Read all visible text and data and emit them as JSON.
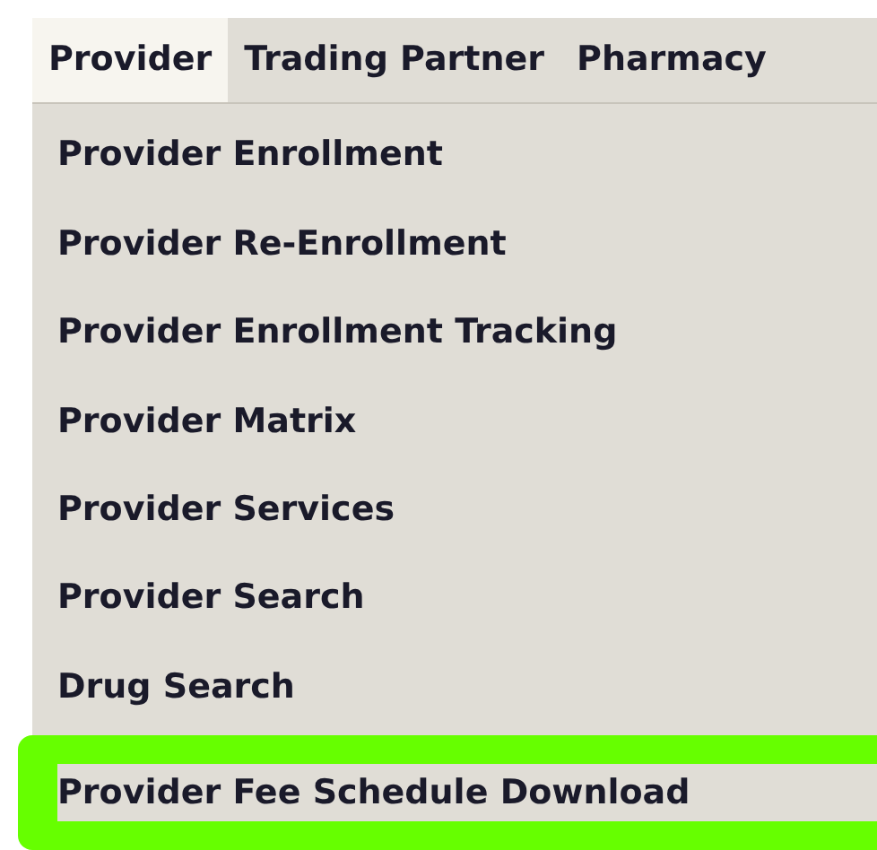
{
  "menu_bar": [
    {
      "label": "Provider",
      "selected": true
    },
    {
      "label": "Trading Partner",
      "selected": false
    },
    {
      "label": "Pharmacy",
      "selected": false
    }
  ],
  "dropdown": {
    "items": [
      {
        "label": "Provider Enrollment",
        "highlighted": false
      },
      {
        "label": "Provider Re-Enrollment",
        "highlighted": false
      },
      {
        "label": "Provider Enrollment Tracking",
        "highlighted": false
      },
      {
        "label": "Provider Matrix",
        "highlighted": false
      },
      {
        "label": "Provider Services",
        "highlighted": false
      },
      {
        "label": "Provider Search",
        "highlighted": false
      },
      {
        "label": "Drug Search",
        "highlighted": false
      },
      {
        "label": "Provider Fee Schedule Download",
        "highlighted": true
      }
    ]
  }
}
